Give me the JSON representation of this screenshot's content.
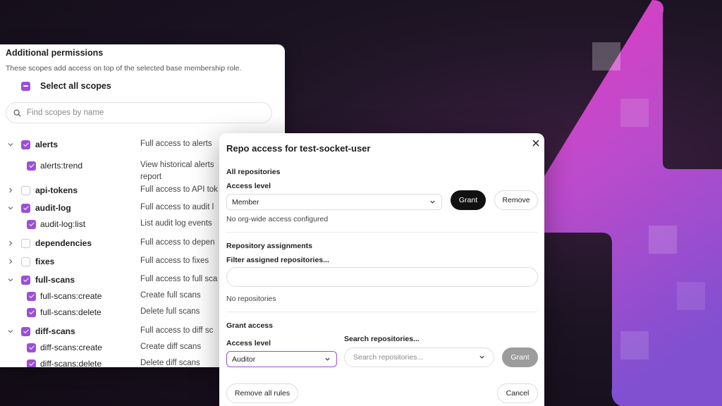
{
  "colors": {
    "accent": "#9b4fd6",
    "bolt": "#e040c8",
    "bg": "#1a1220"
  },
  "permissions": {
    "title": "Additional permissions",
    "subtitle": "These scopes add access on top of the selected base membership role.",
    "select_all_label": "Select all scopes",
    "search_placeholder": "Find scopes by name",
    "rows": [
      {
        "name": "alerts",
        "desc": "Full access to alerts",
        "level": "parent",
        "expanded": true,
        "checked": true
      },
      {
        "name": "alerts:trend",
        "desc": "View historical alerts",
        "desc2": "report",
        "level": "child",
        "checked": true
      },
      {
        "name": "api-tokens",
        "desc": "Full access to API tok",
        "level": "parent",
        "expanded": false,
        "checked": false
      },
      {
        "name": "audit-log",
        "desc": "Full access to audit l",
        "level": "parent",
        "expanded": true,
        "checked": true
      },
      {
        "name": "audit-log:list",
        "desc": "List audit log events",
        "level": "child",
        "checked": true
      },
      {
        "name": "dependencies",
        "desc": "Full access to depen",
        "level": "parent",
        "expanded": false,
        "checked": false
      },
      {
        "name": "fixes",
        "desc": "Full access to fixes",
        "level": "parent",
        "expanded": false,
        "checked": false
      },
      {
        "name": "full-scans",
        "desc": "Full access to full sca",
        "level": "parent",
        "expanded": true,
        "checked": true
      },
      {
        "name": "full-scans:create",
        "desc": "Create full scans",
        "level": "child",
        "checked": true
      },
      {
        "name": "full-scans:delete",
        "desc": "Delete full scans",
        "level": "child",
        "checked": true
      },
      {
        "name": "diff-scans",
        "desc": "Full access to diff sc",
        "level": "parent",
        "expanded": true,
        "checked": true
      },
      {
        "name": "diff-scans:create",
        "desc": "Create diff scans",
        "level": "child",
        "checked": true
      },
      {
        "name": "diff-scans:delete",
        "desc": "Delete diff scans",
        "level": "child",
        "checked": true
      }
    ]
  },
  "modal": {
    "title": "Repo access for test-socket-user",
    "all_repos": {
      "heading": "All repositories",
      "access_label": "Access level",
      "access_value": "Member",
      "grant_label": "Grant",
      "remove_label": "Remove",
      "status": "No org-wide access configured"
    },
    "assignments": {
      "heading": "Repository assignments",
      "filter_label": "Filter assigned repositories...",
      "filter_value": "",
      "empty": "No repositories"
    },
    "grant": {
      "heading": "Grant access",
      "access_label": "Access level",
      "access_value": "Auditor",
      "search_label": "Search repositories...",
      "search_placeholder": "Search repositories...",
      "grant_label": "Grant"
    },
    "remove_all_label": "Remove all rules",
    "cancel_label": "Cancel"
  }
}
